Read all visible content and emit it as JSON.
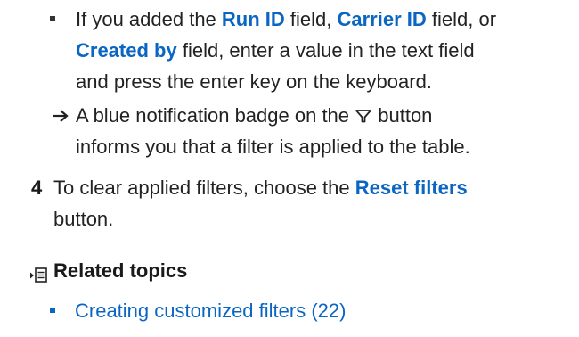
{
  "bullet_filter_fields": {
    "line1_pre": "If you added the ",
    "kw_run_id": "Run ID",
    "line1_mid1": " field, ",
    "kw_carrier_id": "Carrier ID",
    "line1_mid2": " field, or",
    "kw_created_by": "Created by",
    "line2_post": " field, enter a value in the text field",
    "line3": "and press the enter key on the keyboard."
  },
  "result_note": {
    "line1_pre": "A blue notification badge on the ",
    "icon": "filter-icon",
    "line1_post": " button",
    "line2": "informs you that a filter is applied to the table."
  },
  "step4": {
    "number": "4",
    "line1_pre": "To clear applied filters, choose the ",
    "kw_reset_filters": "Reset filters",
    "line2": "button."
  },
  "related_topics": {
    "icon": "related-topics-icon",
    "heading": "Related topics",
    "links": [
      {
        "label": "Creating customized filters (22)"
      }
    ]
  },
  "colors": {
    "accent": "#0a66c2",
    "text": "#222222"
  }
}
